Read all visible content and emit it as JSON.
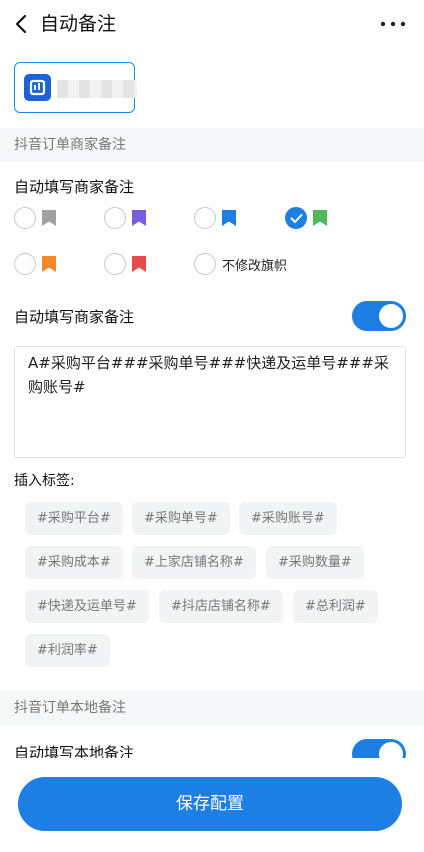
{
  "header": {
    "title": "自动备注"
  },
  "sections": {
    "douyin_merchant": "抖音订单商家备注",
    "douyin_local": "抖音订单本地备注"
  },
  "merchant": {
    "flag_label": "自动填写商家备注",
    "flags": [
      {
        "color": "#a0a0a0",
        "checked": false
      },
      {
        "color": "#7a5ce0",
        "checked": false
      },
      {
        "color": "#1d7fe3",
        "checked": false
      },
      {
        "color": "#4cb85a",
        "checked": true
      },
      {
        "color": "#f08a2c",
        "checked": false
      },
      {
        "color": "#e84a4a",
        "checked": false
      }
    ],
    "no_change_label": "不修改旗帜",
    "note_toggle_label": "自动填写商家备注",
    "note_toggle_on": true,
    "note_text": "A#采购平台###采购单号###快递及运单号###采购账号#",
    "insert_tags_label": "插入标签:",
    "tags": [
      "#采购平台#",
      "#采购单号#",
      "#采购账号#",
      "#采购成本#",
      "#上家店铺名称#",
      "#采购数量#",
      "#快递及运单号#",
      "#抖店店铺名称#",
      "#总利润#",
      "#利润率#"
    ]
  },
  "local": {
    "toggle_label": "自动填写本地备注",
    "toggle_on": true
  },
  "footer": {
    "save_label": "保存配置"
  },
  "colors": {
    "accent": "#1d7fe3"
  }
}
